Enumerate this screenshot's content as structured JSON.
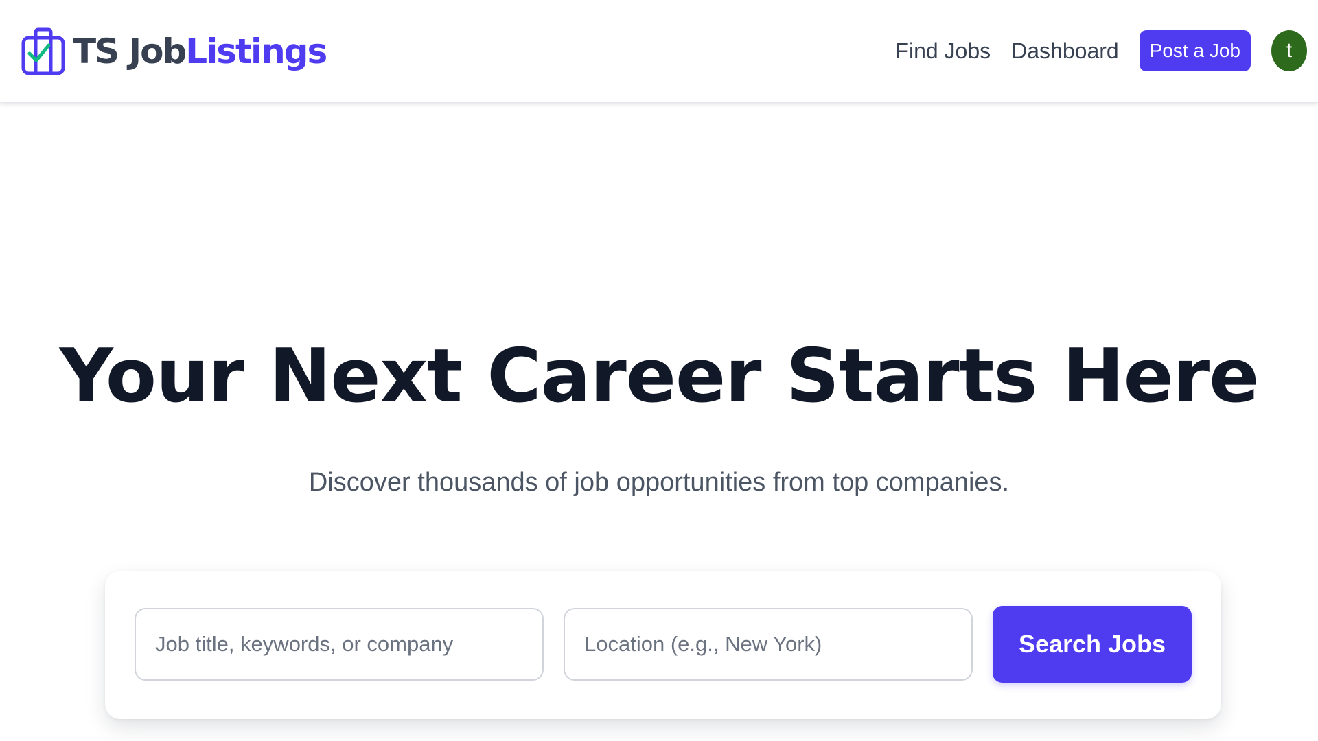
{
  "header": {
    "logo": {
      "part1": "TS Job",
      "part2": "Listings",
      "icon": "briefcase-check-icon"
    },
    "nav": {
      "find_jobs": "Find Jobs",
      "dashboard": "Dashboard",
      "post_job": "Post a Job"
    },
    "avatar_initial": "t"
  },
  "hero": {
    "title": "Your Next Career Starts Here",
    "subtitle": "Discover thousands of job opportunities from top companies."
  },
  "search": {
    "keyword_placeholder": "Job title, keywords, or company",
    "keyword_value": "",
    "location_placeholder": "Location (e.g., New York)",
    "location_value": "",
    "button_label": "Search Jobs"
  },
  "colors": {
    "brand": "#4f3bf0",
    "heading": "#111827",
    "text": "#374151",
    "muted": "#4b5563",
    "avatar": "#2e6a1c",
    "check": "#10b981"
  }
}
